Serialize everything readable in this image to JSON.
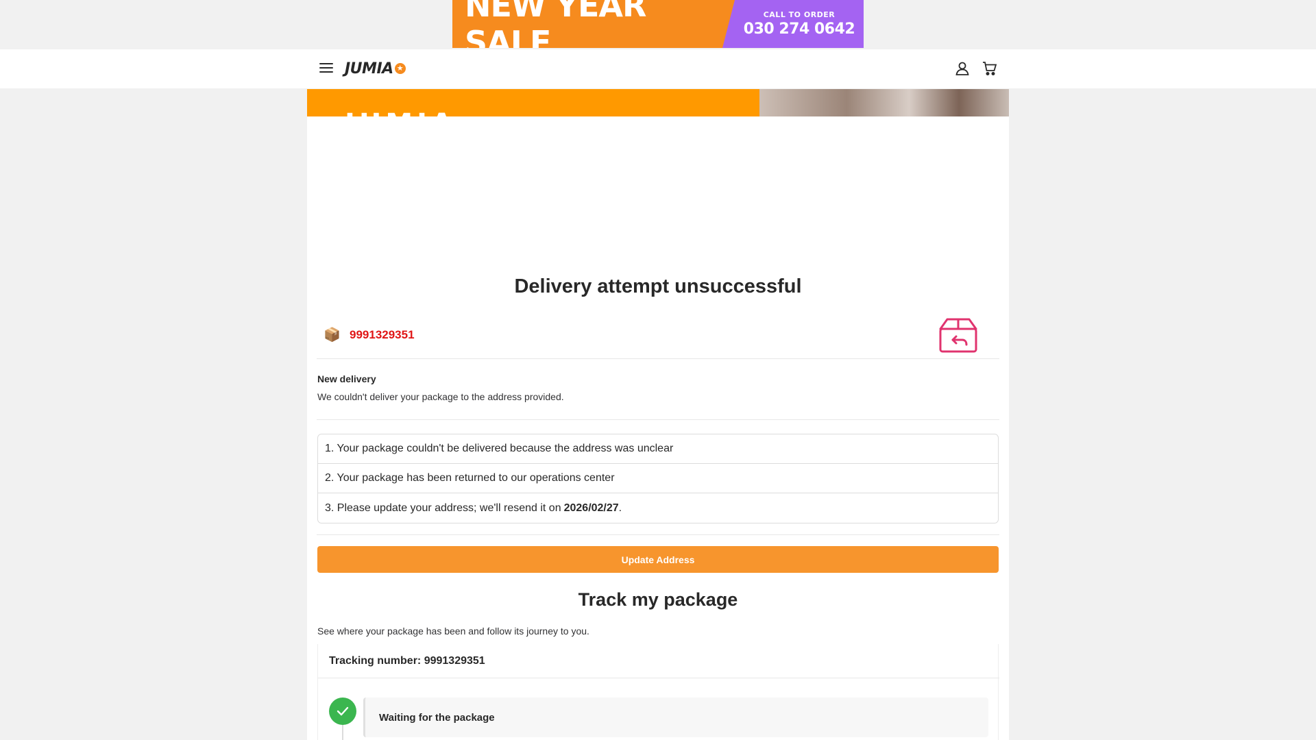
{
  "promo": {
    "headline": "NEW YEAR SALE",
    "call_label": "CALL TO ORDER",
    "phone": "030 274 0642",
    "colors": {
      "left": "#f68b1e",
      "right": "#a463f2"
    }
  },
  "header": {
    "logo_text": "JUMIA",
    "icons": [
      "menu-icon",
      "account-icon",
      "cart-icon"
    ]
  },
  "hero": {
    "text": "JUMIA"
  },
  "delivery": {
    "title": "Delivery attempt unsuccessful",
    "order_number": "9991329351",
    "new_delivery_title": "New delivery",
    "new_delivery_desc": "We couldn't deliver your package to the address provided.",
    "steps": [
      {
        "text": "1. Your package couldn't be delivered because the address was unclear"
      },
      {
        "text": "2. Your package has been returned to our operations center"
      },
      {
        "text": "3. Please update your address; we'll resend it on",
        "date": "2026/02/27",
        "suffix": "."
      }
    ],
    "update_button": "Update Address"
  },
  "tracking": {
    "title": "Track my package",
    "description": "See where your package has been and follow its journey to you.",
    "tracking_label": "Tracking number: 9991329351",
    "events": [
      {
        "label": "Waiting for the package",
        "status": "complete"
      }
    ]
  },
  "colors": {
    "accent": "#f68b1e",
    "button": "#f7952d",
    "order_number": "#e01515",
    "success": "#3bb64f",
    "return_icon": "#e0336e"
  }
}
